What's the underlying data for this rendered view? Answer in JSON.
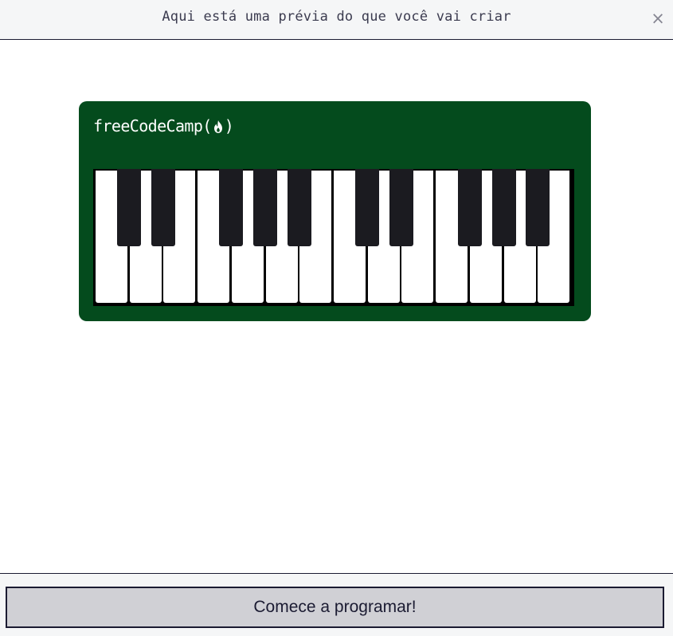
{
  "header": {
    "title": "Aqui está uma prévia do que você vai criar",
    "close_label": "×",
    "close_icon": "close-icon"
  },
  "preview": {
    "logo_prefix": "freeCodeCamp(",
    "logo_suffix": ")",
    "logo_icon": "flame-icon",
    "colors": {
      "piano_body": "#044b1d",
      "white_key": "#ffffff",
      "black_key": "#1b1b20"
    },
    "keys": {
      "white_count": 14,
      "black_pattern": [
        "C#",
        "D#",
        "F#",
        "G#",
        "A#",
        "C#",
        "D#",
        "F#",
        "G#",
        "A#"
      ]
    }
  },
  "footer": {
    "start_label": "Comece a programar!"
  }
}
